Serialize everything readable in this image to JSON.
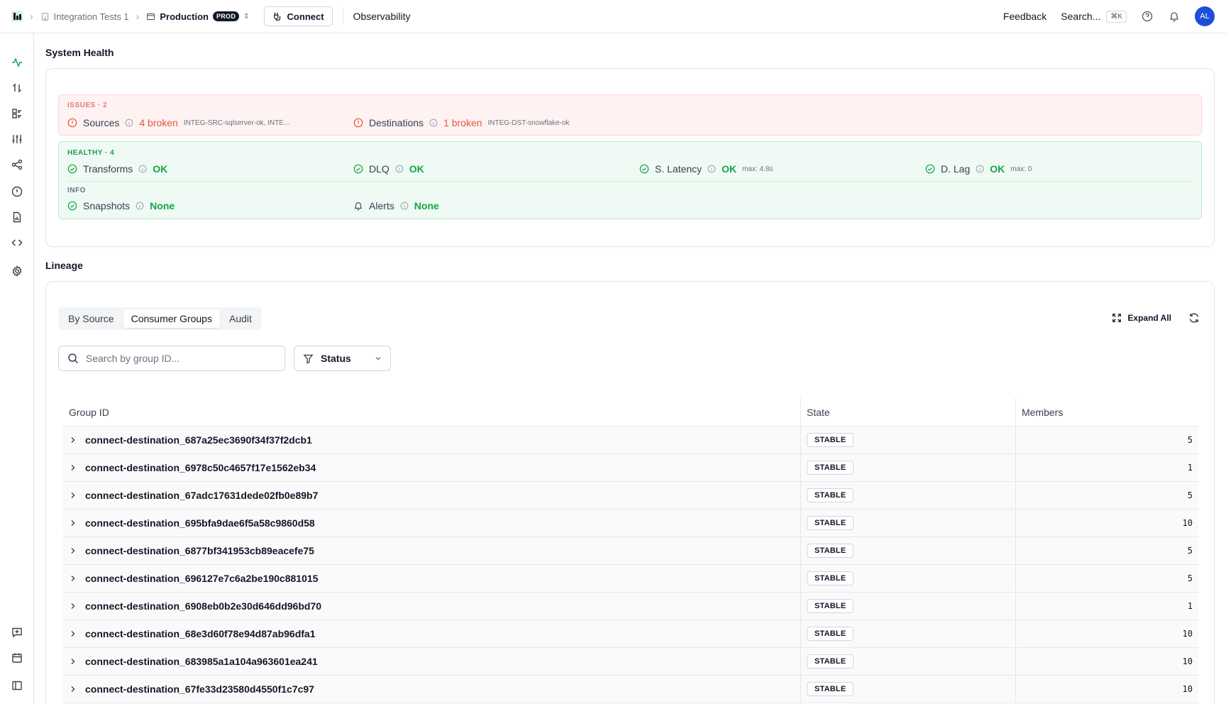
{
  "topbar": {
    "project": "Integration Tests 1",
    "environment": "Production",
    "environment_badge": "PROD",
    "connect_label": "Connect",
    "page": "Observability",
    "feedback_label": "Feedback",
    "search_label": "Search...",
    "search_shortcut": "⌘K",
    "avatar_initials": "AL"
  },
  "system_health": {
    "title": "System Health",
    "issues": {
      "label": "ISSUES · 2",
      "items": [
        {
          "name": "Sources",
          "value": "4 broken",
          "detail": "INTEG-SRC-sqlserver-ok, INTE..."
        },
        {
          "name": "Destinations",
          "value": "1 broken",
          "detail": "INTEG-DST-snowflake-ok"
        }
      ]
    },
    "healthy": {
      "label": "HEALTHY · 4",
      "items": [
        {
          "name": "Transforms",
          "value": "OK",
          "detail": ""
        },
        {
          "name": "DLQ",
          "value": "OK",
          "detail": ""
        },
        {
          "name": "S. Latency",
          "value": "OK",
          "detail": "max: 4.8s"
        },
        {
          "name": "D. Lag",
          "value": "OK",
          "detail": "max: 0"
        }
      ]
    },
    "info": {
      "label": "INFO",
      "items": [
        {
          "name": "Snapshots",
          "value": "None"
        },
        {
          "name": "Alerts",
          "value": "None"
        }
      ]
    }
  },
  "lineage": {
    "title": "Lineage",
    "tabs": [
      {
        "label": "By Source",
        "active": false
      },
      {
        "label": "Consumer Groups",
        "active": true
      },
      {
        "label": "Audit",
        "active": false
      }
    ],
    "expand_all_label": "Expand All",
    "search_placeholder": "Search by group ID...",
    "status_filter_label": "Status",
    "columns": {
      "group_id": "Group ID",
      "state": "State",
      "members": "Members"
    },
    "rows": [
      {
        "group_id": "connect-destination_687a25ec3690f34f37f2dcb1",
        "state": "STABLE",
        "members": "5"
      },
      {
        "group_id": "connect-destination_6978c50c4657f17e1562eb34",
        "state": "STABLE",
        "members": "1"
      },
      {
        "group_id": "connect-destination_67adc17631dede02fb0e89b7",
        "state": "STABLE",
        "members": "5"
      },
      {
        "group_id": "connect-destination_695bfa9dae6f5a58c9860d58",
        "state": "STABLE",
        "members": "10"
      },
      {
        "group_id": "connect-destination_6877bf341953cb89eacefe75",
        "state": "STABLE",
        "members": "5"
      },
      {
        "group_id": "connect-destination_696127e7c6a2be190c881015",
        "state": "STABLE",
        "members": "5"
      },
      {
        "group_id": "connect-destination_6908eb0b2e30d646dd96bd70",
        "state": "STABLE",
        "members": "1"
      },
      {
        "group_id": "connect-destination_68e3d60f78e94d87ab96dfa1",
        "state": "STABLE",
        "members": "10"
      },
      {
        "group_id": "connect-destination_683985a1a104a963601ea241",
        "state": "STABLE",
        "members": "10"
      },
      {
        "group_id": "connect-destination_67fe33d23580d4550f1c7c97",
        "state": "STABLE",
        "members": "10"
      }
    ]
  },
  "colors": {
    "accent_green": "#16a34a",
    "issue_red": "#dc5a3c",
    "avatar_blue": "#1d4ed8"
  },
  "sidebar_icons": [
    "activity-icon",
    "transfer-icon",
    "list-icon",
    "sliders-icon",
    "share-icon",
    "alert-icon",
    "document-icon",
    "code-icon",
    "settings-icon",
    "chat-plus-icon",
    "calendar-icon",
    "panel-icon"
  ]
}
